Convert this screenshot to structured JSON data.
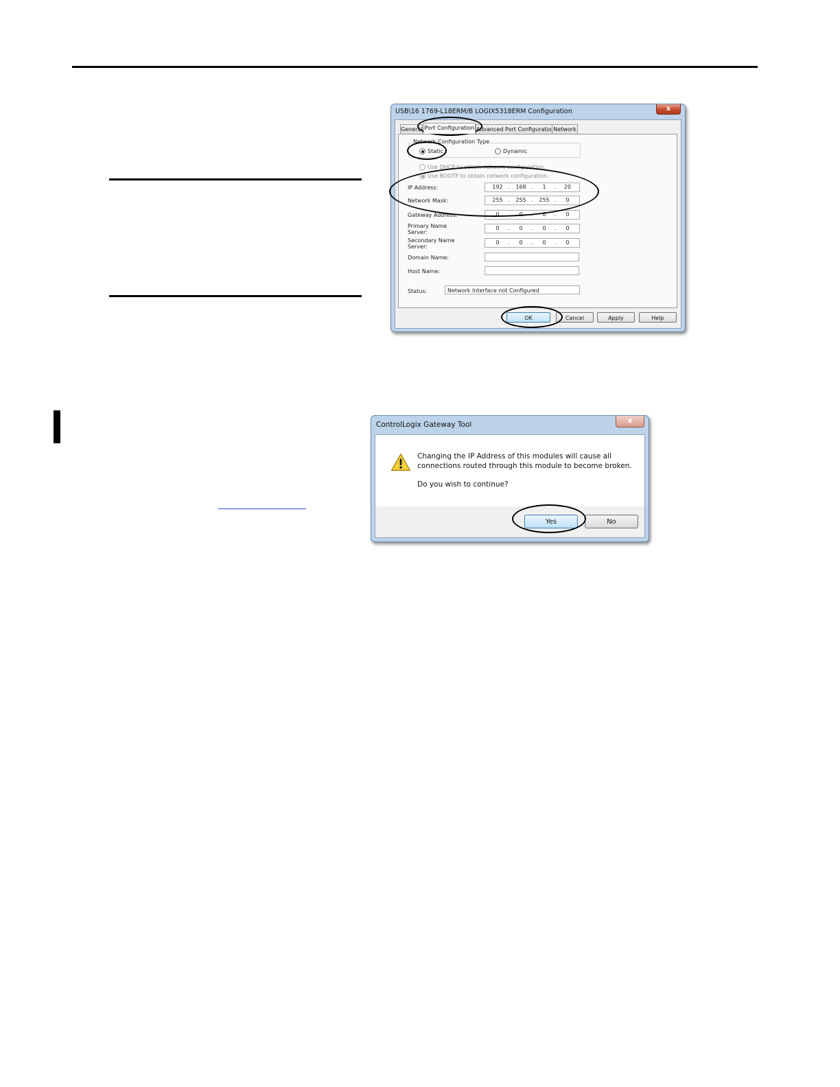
{
  "config_dialog": {
    "title": "USB\\16 1769-L18ERM/B LOGIX5318ERM Configuration",
    "close_glyph": "x",
    "tabs": [
      {
        "label": "General"
      },
      {
        "label": "Port Configuration"
      },
      {
        "label": "Advanced Port Configuration"
      },
      {
        "label": "Network"
      }
    ],
    "network_config_type": {
      "group_label": "Network Configuration Type",
      "static_label": "Static",
      "dynamic_label": "Dynamic",
      "selected": "Static"
    },
    "dhcp_label": "Use DHCP to obtain network configuration.",
    "bootp_label": "Use BOOTP to obtain network configuration.",
    "ip_address": {
      "label": "IP Address:",
      "octets": [
        "192",
        "168",
        "1",
        "20"
      ]
    },
    "network_mask": {
      "label": "Network Mask:",
      "octets": [
        "255",
        "255",
        "255",
        "0"
      ]
    },
    "gateway_address": {
      "label": "Gateway Address:",
      "octets": [
        "0",
        "0",
        "0",
        "0"
      ]
    },
    "primary_name_server": {
      "label_line1": "Primary Name",
      "label_line2": "Server:",
      "octets": [
        "0",
        "0",
        "0",
        "0"
      ]
    },
    "secondary_name_server": {
      "label_line1": "Secondary Name",
      "label_line2": "Server:",
      "octets": [
        "0",
        "0",
        "0",
        "0"
      ]
    },
    "domain_name": {
      "label": "Domain Name:",
      "value": ""
    },
    "host_name": {
      "label": "Host Name:",
      "value": ""
    },
    "status": {
      "label": "Status:",
      "value": "Network Interface not Configured"
    },
    "buttons": {
      "ok": "OK",
      "cancel": "Cancel",
      "apply": "Apply",
      "help": "Help"
    }
  },
  "message_box": {
    "title": "ControlLogix Gateway Tool",
    "close_glyph": "x",
    "icon": "warning-icon",
    "message_line1": "Changing the IP Address of this modules will cause all",
    "message_line2": "connections routed through this module to become broken.",
    "question": "Do you wish to continue?",
    "buttons": {
      "yes": "Yes",
      "no": "No"
    }
  },
  "colors": {
    "window_frame": "#bcd3ea",
    "close_button": "#c24a2c",
    "default_button_border": "#3c7fb1",
    "annotation_ellipse": "#000000",
    "link_underline": "#2a4bd7"
  }
}
